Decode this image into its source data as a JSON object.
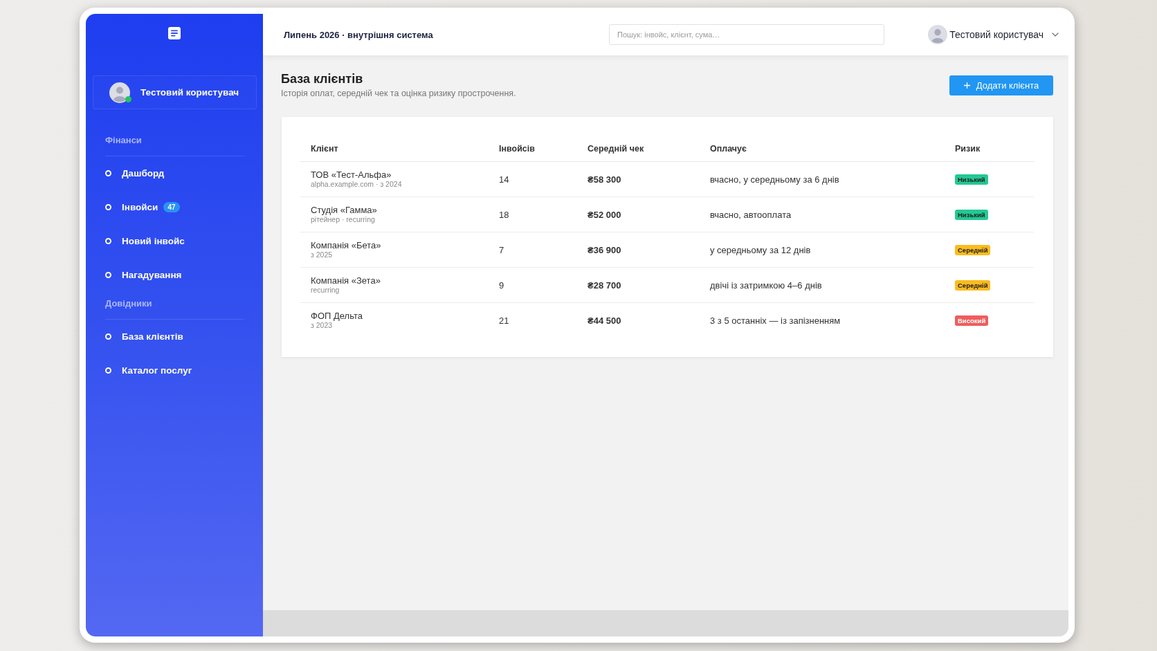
{
  "sidebar": {
    "user": {
      "name": "Тестовий користувач",
      "online": true
    },
    "sections": [
      {
        "title": "Фінанси",
        "items": [
          {
            "label": "Дашборд"
          },
          {
            "label": "Інвойси",
            "badge": "47"
          },
          {
            "label": "Новий інвойс"
          },
          {
            "label": "Нагадування"
          }
        ]
      },
      {
        "title": "Довідники",
        "items": [
          {
            "label": "База клієнтів"
          },
          {
            "label": "Каталог послуг"
          }
        ]
      }
    ]
  },
  "header": {
    "title": "Липень 2026 · внутрішня система",
    "search": {
      "placeholder": "Пошук: інвойс, клієнт, сума…"
    },
    "user": {
      "name": "Тестовий користувач"
    }
  },
  "page": {
    "title": "База клієнтів",
    "subtitle": "Історія оплат, середній чек та оцінка ризику прострочення.",
    "add_button": {
      "label": "Додати клієнта"
    }
  },
  "table": {
    "columns": [
      "Клієнт",
      "Інвойсів",
      "Середній чек",
      "Оплачує",
      "Ризик"
    ],
    "rows": [
      {
        "client": "ТОВ «Тест-Альфа»",
        "details": "alpha.example.com · з 2024",
        "invoices": "14",
        "avg_check": "₴58 300",
        "payment": "вчасно, у середньому за 6 днів",
        "risk": {
          "label": "Низький",
          "color": "#22c993"
        }
      },
      {
        "client": "Студія «Гамма»",
        "details": "рітейнер · recurring",
        "invoices": "18",
        "avg_check": "₴52 000",
        "payment": "вчасно, автооплата",
        "risk": {
          "label": "Низький",
          "color": "#22c993"
        }
      },
      {
        "client": "Компанія «Бета»",
        "details": "з 2025",
        "invoices": "7",
        "avg_check": "₴36 900",
        "payment": "у середньому за 12 днів",
        "risk": {
          "label": "Середній",
          "color": "#fbbc1f"
        }
      },
      {
        "client": "Компанія «Зета»",
        "details": "recurring",
        "invoices": "9",
        "avg_check": "₴28 700",
        "payment": "двічі із затримкою 4–6 днів",
        "risk": {
          "label": "Середній",
          "color": "#fbbc1f"
        }
      },
      {
        "client": "ФОП Дельта",
        "details": "з 2023",
        "invoices": "21",
        "avg_check": "₴44 500",
        "payment": "3 з 5 останніх — із запізненням",
        "risk": {
          "label": "Високий",
          "color": "#ef5d5d"
        }
      }
    ]
  }
}
